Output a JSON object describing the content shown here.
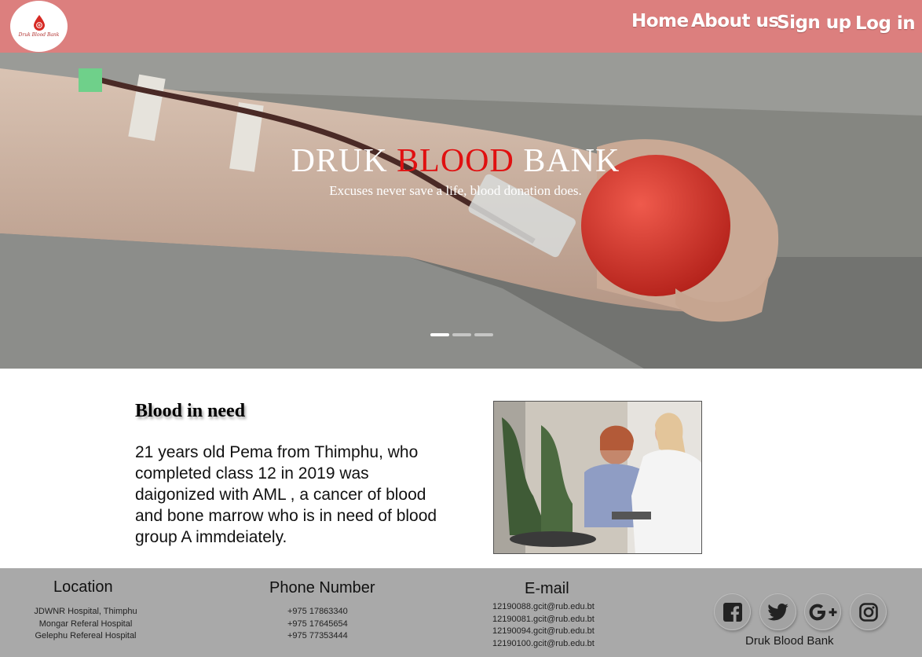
{
  "header": {
    "logo_text": "Druk Blood Bank",
    "nav": {
      "home": "Home",
      "about": "About us",
      "signup": "Sign up",
      "login": "Log in"
    },
    "colors": {
      "bar": "#dc7f7e",
      "nav_text": "#ffffff"
    }
  },
  "hero": {
    "title_part1": "DRUK",
    "title_part2": "BLOOD",
    "title_part3": "BANK",
    "subtitle": "Excuses never save a life, blood donation does.",
    "slides": 3,
    "active_slide": 1,
    "accent_color": "#e01010"
  },
  "need": {
    "title": "Blood in need",
    "text": "21 years old Pema from Thimphu, who completed class 12 in 2019 was daigonized with AML , a cancer  of blood and bone marrow who is in need of blood group A immdeiately."
  },
  "footer": {
    "location": {
      "title": "Location",
      "items": [
        "JDWNR Hospital, Thimphu",
        "Mongar Referal Hospital",
        "Gelephu Refereal Hospital"
      ]
    },
    "phone": {
      "title": "Phone Number",
      "items": [
        "+975 17863340",
        "+975 17645654",
        "+975 77353444"
      ]
    },
    "email": {
      "title": "E-mail",
      "items": [
        "12190088.gcit@rub.edu.bt",
        "12190081.gcit@rub.edu.bt",
        "12190094.gcit@rub.edu.bt",
        "12190100.gcit@rub.edu.bt"
      ]
    },
    "social_icons": [
      "facebook-icon",
      "twitter-icon",
      "google-plus-icon",
      "instagram-icon"
    ],
    "brand": "Druk Blood Bank",
    "background": "#a9a9a9"
  }
}
